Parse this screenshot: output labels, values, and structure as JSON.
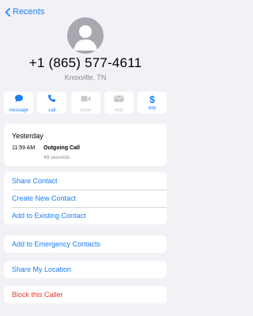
{
  "nav": {
    "back_label": "Recents"
  },
  "contact": {
    "phone": "+1 (865) 577-4611",
    "location": "Knoxville, TN"
  },
  "actions": [
    {
      "label": "message",
      "icon": "message-bubble-icon",
      "enabled": true
    },
    {
      "label": "call",
      "icon": "phone-icon",
      "enabled": true
    },
    {
      "label": "video",
      "icon": "video-camera-icon",
      "enabled": false
    },
    {
      "label": "mail",
      "icon": "envelope-icon",
      "enabled": false
    },
    {
      "label": "pay",
      "icon": "dollar-sign-icon",
      "enabled": true
    }
  ],
  "history": {
    "day": "Yesterday",
    "time": "11:59 AM",
    "type": "Outgoing Call",
    "duration": "49 seconds"
  },
  "options": {
    "share_contact": "Share Contact",
    "create_new_contact": "Create New Contact",
    "add_to_existing": "Add to Existing Contact",
    "add_to_emergency": "Add to Emergency Contacts",
    "share_location": "Share My Location",
    "block_caller": "Block this Caller"
  },
  "colors": {
    "accent": "#1a7ef5",
    "danger": "#e6392f",
    "disabled": "#c6c6cb",
    "background": "#f2f2f6",
    "secondary_text": "#8a8a8e"
  }
}
